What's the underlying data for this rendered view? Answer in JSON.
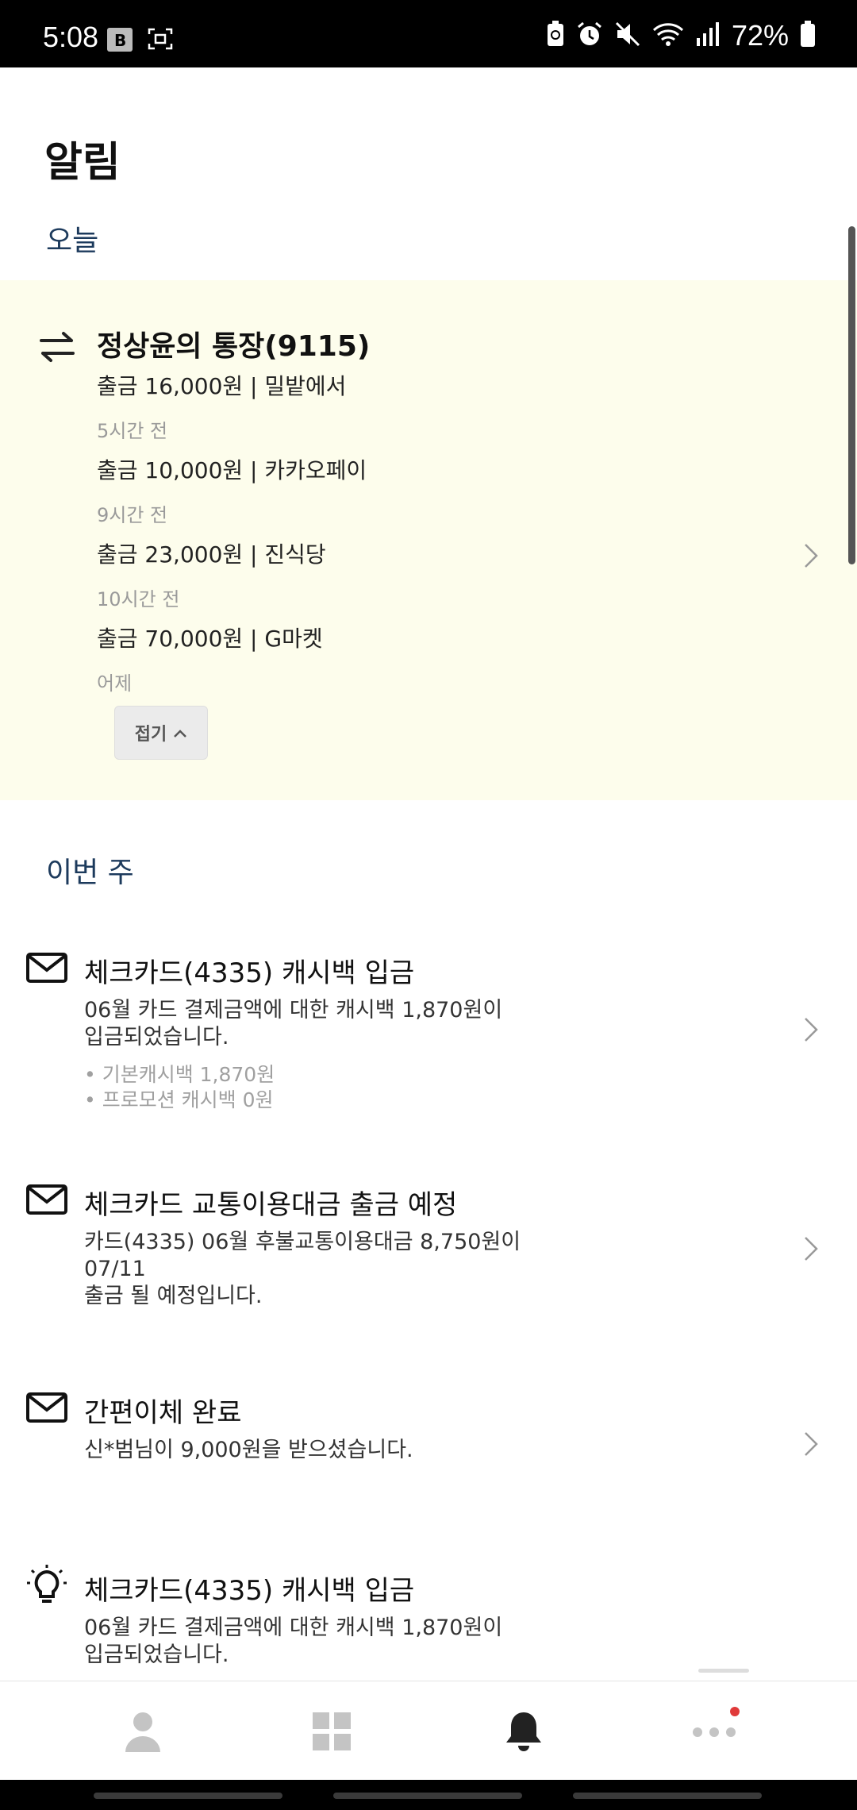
{
  "status_bar": {
    "time": "5:08",
    "battery": "72%",
    "icons": [
      "b-box-icon",
      "screenshot-icon",
      "battery-saver-icon",
      "alarm-icon",
      "mute-icon",
      "wifi-icon",
      "signal-icon",
      "battery-icon"
    ]
  },
  "header": {
    "title": "알림"
  },
  "sections": {
    "today": "오늘",
    "this_week": "이번 주"
  },
  "account_card": {
    "title": "정상윤의 통장(9115)",
    "transactions": [
      {
        "text": "출금 16,000원 | 밀밭에서",
        "time": "5시간 전"
      },
      {
        "text": "출금 10,000원 | 카카오페이",
        "time": "9시간 전"
      },
      {
        "text": "출금 23,000원 | 진식당",
        "time": "10시간 전"
      },
      {
        "text": "출금 70,000원 | G마켓",
        "time": "어제"
      }
    ],
    "collapse_label": "접기"
  },
  "notifications": [
    {
      "icon": "envelope-icon",
      "title": "체크카드(4335) 캐시백 입금",
      "body": [
        "06월 카드 결제금액에 대한 캐시백 1,870원이",
        "입금되었습니다."
      ],
      "sub": [
        "• 기본캐시백 1,870원",
        "• 프로모션 캐시백 0원"
      ]
    },
    {
      "icon": "envelope-icon",
      "title": "체크카드 교통이용대금 출금 예정",
      "body": [
        "카드(4335) 06월 후불교통이용대금 8,750원이 07/11",
        "출금 될 예정입니다."
      ]
    },
    {
      "icon": "envelope-icon",
      "title": "간편이체 완료",
      "body": [
        "신*범님이 9,000원을 받으셨습니다."
      ]
    },
    {
      "icon": "lightbulb-icon",
      "title": "체크카드(4335) 캐시백 입금",
      "body": [
        "06월 카드 결제금액에 대한 캐시백 1,870원이",
        "입금되었습니다."
      ]
    }
  ],
  "bottom_nav": {
    "items": [
      "person-icon",
      "grid-icon",
      "bell-icon",
      "more-icon"
    ],
    "active": "bell-icon",
    "colors": {
      "inactive": "#c4c4c4",
      "active": "#222222",
      "badge": "#e03a3a"
    }
  },
  "colors": {
    "card_background": "#fdfdec",
    "section_label": "#1c3a5c"
  }
}
